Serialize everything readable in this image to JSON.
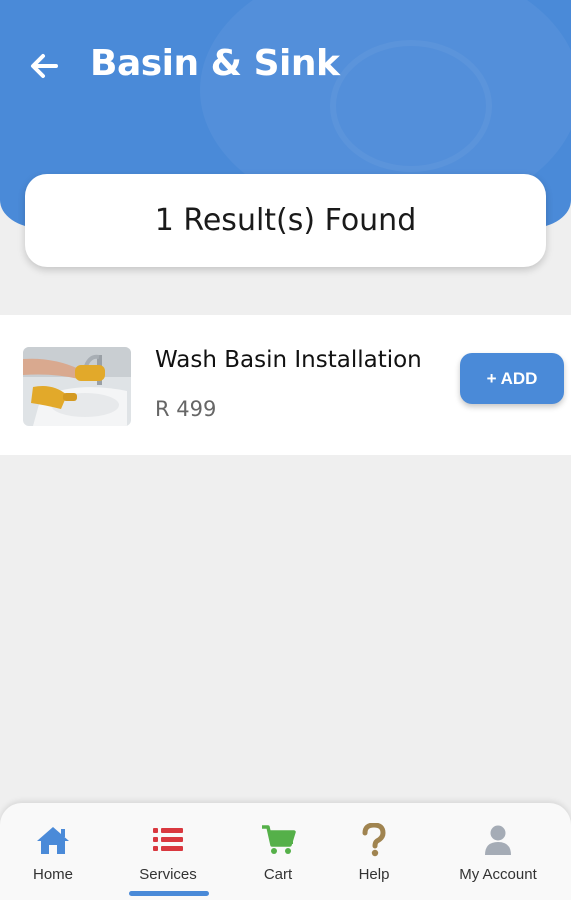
{
  "header": {
    "title": "Basin & Sink",
    "back_icon": "arrow-left-icon",
    "color": "#4a8ad8"
  },
  "results": {
    "summary": "1 Result(s) Found"
  },
  "services": [
    {
      "name": "Wash Basin Installation",
      "price": "R 499",
      "image": "wash-basin-photo",
      "add_label": "+ ADD"
    }
  ],
  "bottom_nav": {
    "active": "Services",
    "items": [
      {
        "label": "Home",
        "icon": "home-icon",
        "color": "#4a8ad8"
      },
      {
        "label": "Services",
        "icon": "list-icon",
        "color": "#d9383f"
      },
      {
        "label": "Cart",
        "icon": "cart-icon",
        "color": "#55b049"
      },
      {
        "label": "Help",
        "icon": "question-icon",
        "color": "#a08450"
      },
      {
        "label": "My Account",
        "icon": "user-icon",
        "color": "#a5acb6"
      }
    ]
  }
}
